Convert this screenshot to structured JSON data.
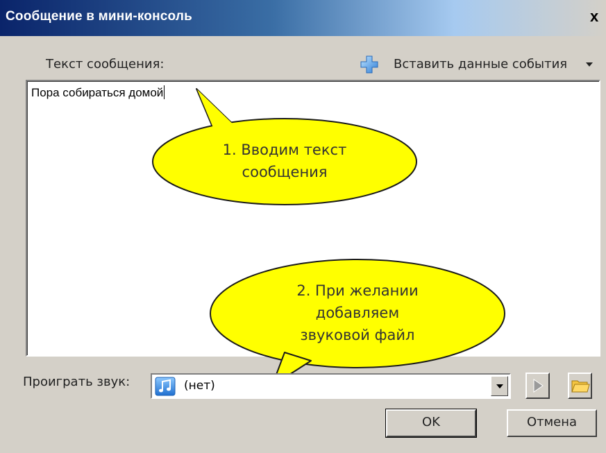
{
  "window": {
    "title": "Сообщение в мини-консоль",
    "close_glyph": "x"
  },
  "message": {
    "label": "Текст сообщения:",
    "text": "Пора собираться домой"
  },
  "insert_event": {
    "label": "Вставить данные события",
    "icon": "plus-icon"
  },
  "callouts": [
    {
      "lines": [
        "1. Вводим текст",
        "сообщения"
      ]
    },
    {
      "lines": [
        "2. При желании",
        "добавляем",
        "звуковой файл"
      ]
    }
  ],
  "sound": {
    "label": "Проиграть звук:",
    "value": "(нет)",
    "icon": "music-note-icon"
  },
  "buttons": {
    "ok": "OK",
    "cancel": "Отмена"
  },
  "colors": {
    "dialog_bg": "#d4d0c8",
    "titlebar_start": "#0a246a",
    "callout_fill": "#ffff00",
    "callout_stroke": "#1a1a1a"
  }
}
